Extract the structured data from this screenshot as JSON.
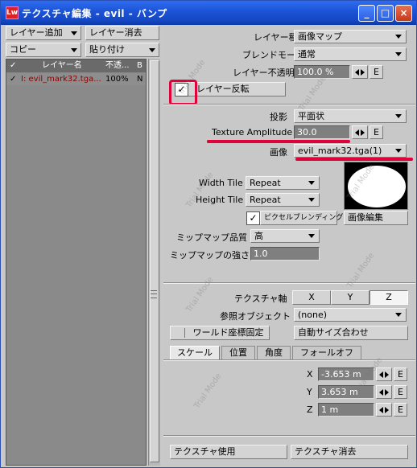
{
  "window": {
    "title": "テクスチャ編集 - evil - バンプ",
    "app_icon_text": "Lw"
  },
  "left_panel": {
    "add_layer": "レイヤー追加",
    "delete_layer": "レイヤー消去",
    "copy": "コピー",
    "paste": "貼り付け",
    "columns": [
      "レイヤー名",
      "不透...",
      "B"
    ],
    "rows": [
      {
        "checked": "✓",
        "name": "I: evil_mark32.tga...",
        "opacity": "100%",
        "blend": "N"
      }
    ]
  },
  "layer": {
    "type_label": "レイヤー種",
    "type_value": "画像マップ",
    "blend_label": "ブレンドモード",
    "blend_value": "通常",
    "opacity_label": "レイヤー不透明度",
    "opacity_value": "100.0 %",
    "invert_label": "レイヤー反転",
    "invert_checked": "✓"
  },
  "projection": {
    "projection_label": "投影",
    "projection_value": "平面状",
    "amplitude_label": "Texture Amplitude",
    "amplitude_value": "30.0",
    "image_label": "画像",
    "image_value": "evil_mark32.tga(1)",
    "width_tile_label": "Width Tile",
    "width_tile_value": "Repeat",
    "height_tile_label": "Height Tile",
    "height_tile_value": "Repeat",
    "pixel_blending_label": "ピクセルブレンディング",
    "pixel_blending_checked": "✓",
    "image_edit": "画像編集",
    "mipmap_quality_label": "ミップマップ品質",
    "mipmap_quality_value": "高",
    "mipmap_strength_label": "ミップマップの強さ",
    "mipmap_strength_value": "1.0"
  },
  "axis": {
    "label": "テクスチャ軸",
    "options": [
      "X",
      "Y",
      "Z"
    ],
    "selected": "Z",
    "ref_object_label": "参照オブジェクト",
    "ref_object_value": "(none)",
    "world_coords": "ワールド座標固定",
    "auto_size": "自動サイズ合わせ"
  },
  "transform": {
    "tabs": [
      "スケール",
      "位置",
      "角度",
      "フォールオフ"
    ],
    "active_tab": "スケール",
    "x_label": "X",
    "x_value": "-3.653 m",
    "y_label": "Y",
    "y_value": "3.653 m",
    "z_label": "Z",
    "z_value": "1 m",
    "e_label": "E"
  },
  "footer": {
    "use_texture": "テクスチャ使用",
    "delete_texture": "テクスチャ消去"
  },
  "watermark": "Trial Mode",
  "colors": {
    "annotation_red": "#e0003a",
    "title_blue": "#1d55d8"
  }
}
